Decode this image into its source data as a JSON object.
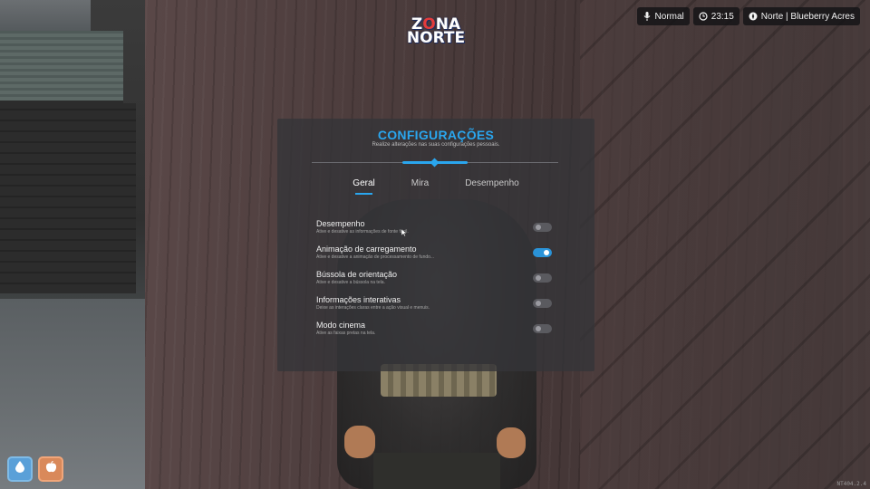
{
  "logo": {
    "line1_pre": "Z",
    "line1_o": "O",
    "line1_post": "NA",
    "line2": "NORTE"
  },
  "hud": {
    "voice_mode": "Normal",
    "time": "23:15",
    "location": "Norte | Blueberry Acres"
  },
  "panel": {
    "title": "CONFIGURAÇÕES",
    "subtitle": "Realize alterações nas suas configurações pessoais.",
    "accent_color": "#2aa6ee",
    "tabs": [
      {
        "label": "Geral",
        "active": true
      },
      {
        "label": "Mira",
        "active": false
      },
      {
        "label": "Desempenho",
        "active": false
      }
    ],
    "settings": [
      {
        "title": "Desempenho",
        "description": "Ative e desative as informações de fonte fácil.",
        "enabled": false
      },
      {
        "title": "Animação de carregamento",
        "description": "Ative e desative a animação de processamento de fundo...",
        "enabled": true
      },
      {
        "title": "Bússola de orientação",
        "description": "Ative e desative a bússola na tela.",
        "enabled": false
      },
      {
        "title": "Informações interativas",
        "description": "Deixe as interações claras entre a ação visual e menuis.",
        "enabled": false
      },
      {
        "title": "Modo cinema",
        "description": "Ative as faixas pretas na tela.",
        "enabled": false
      }
    ]
  },
  "status": {
    "water_icon": "water-drop-icon",
    "food_icon": "apple-icon"
  },
  "version": "NT404.2.4"
}
